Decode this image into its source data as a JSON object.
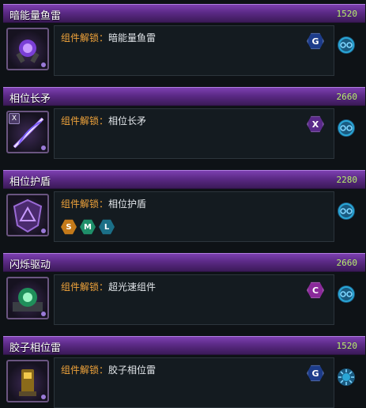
{
  "unlock_label": "组件解锁：",
  "colors": {
    "header_purple": "#6a3398",
    "cost_green": "#b6ef6a",
    "label_orange": "#f0a33a",
    "panel_bg": "#141b20",
    "badge_g": "#1d3c8a",
    "badge_x": "#5a2a8a",
    "badge_c": "#8a2a9a",
    "hex_s": "#c47a1a",
    "hex_m": "#1f8f6a",
    "hex_l": "#1b6f87",
    "wheel_icon": "#2aa6d6"
  },
  "items": [
    {
      "name": "暗能量鱼雷",
      "cost": "1520",
      "unlocks": "暗能量鱼雷",
      "badge": "G",
      "thumb_icon": "torpedo-icon",
      "action_icon": "gear-wheel-icon",
      "corner_badge": ""
    },
    {
      "name": "相位长矛",
      "cost": "2660",
      "unlocks": "相位长矛",
      "badge": "X",
      "thumb_icon": "lance-icon",
      "action_icon": "gear-wheel-icon",
      "corner_badge": "X"
    },
    {
      "name": "相位护盾",
      "cost": "2280",
      "unlocks": "相位护盾",
      "badge": "",
      "thumb_icon": "shield-icon",
      "action_icon": "gear-wheel-icon",
      "corner_badge": "",
      "sizes": [
        "S",
        "M",
        "L"
      ]
    },
    {
      "name": "闪烁驱动",
      "cost": "2660",
      "unlocks": "超光速组件",
      "badge": "C",
      "thumb_icon": "blink-drive-icon",
      "action_icon": "gear-wheel-icon",
      "corner_badge": ""
    },
    {
      "name": "胶子相位雷",
      "cost": "1520",
      "unlocks": "胶子相位雷",
      "badge": "G",
      "thumb_icon": "mine-icon",
      "action_icon": "sun-gear-icon",
      "corner_badge": ""
    }
  ]
}
